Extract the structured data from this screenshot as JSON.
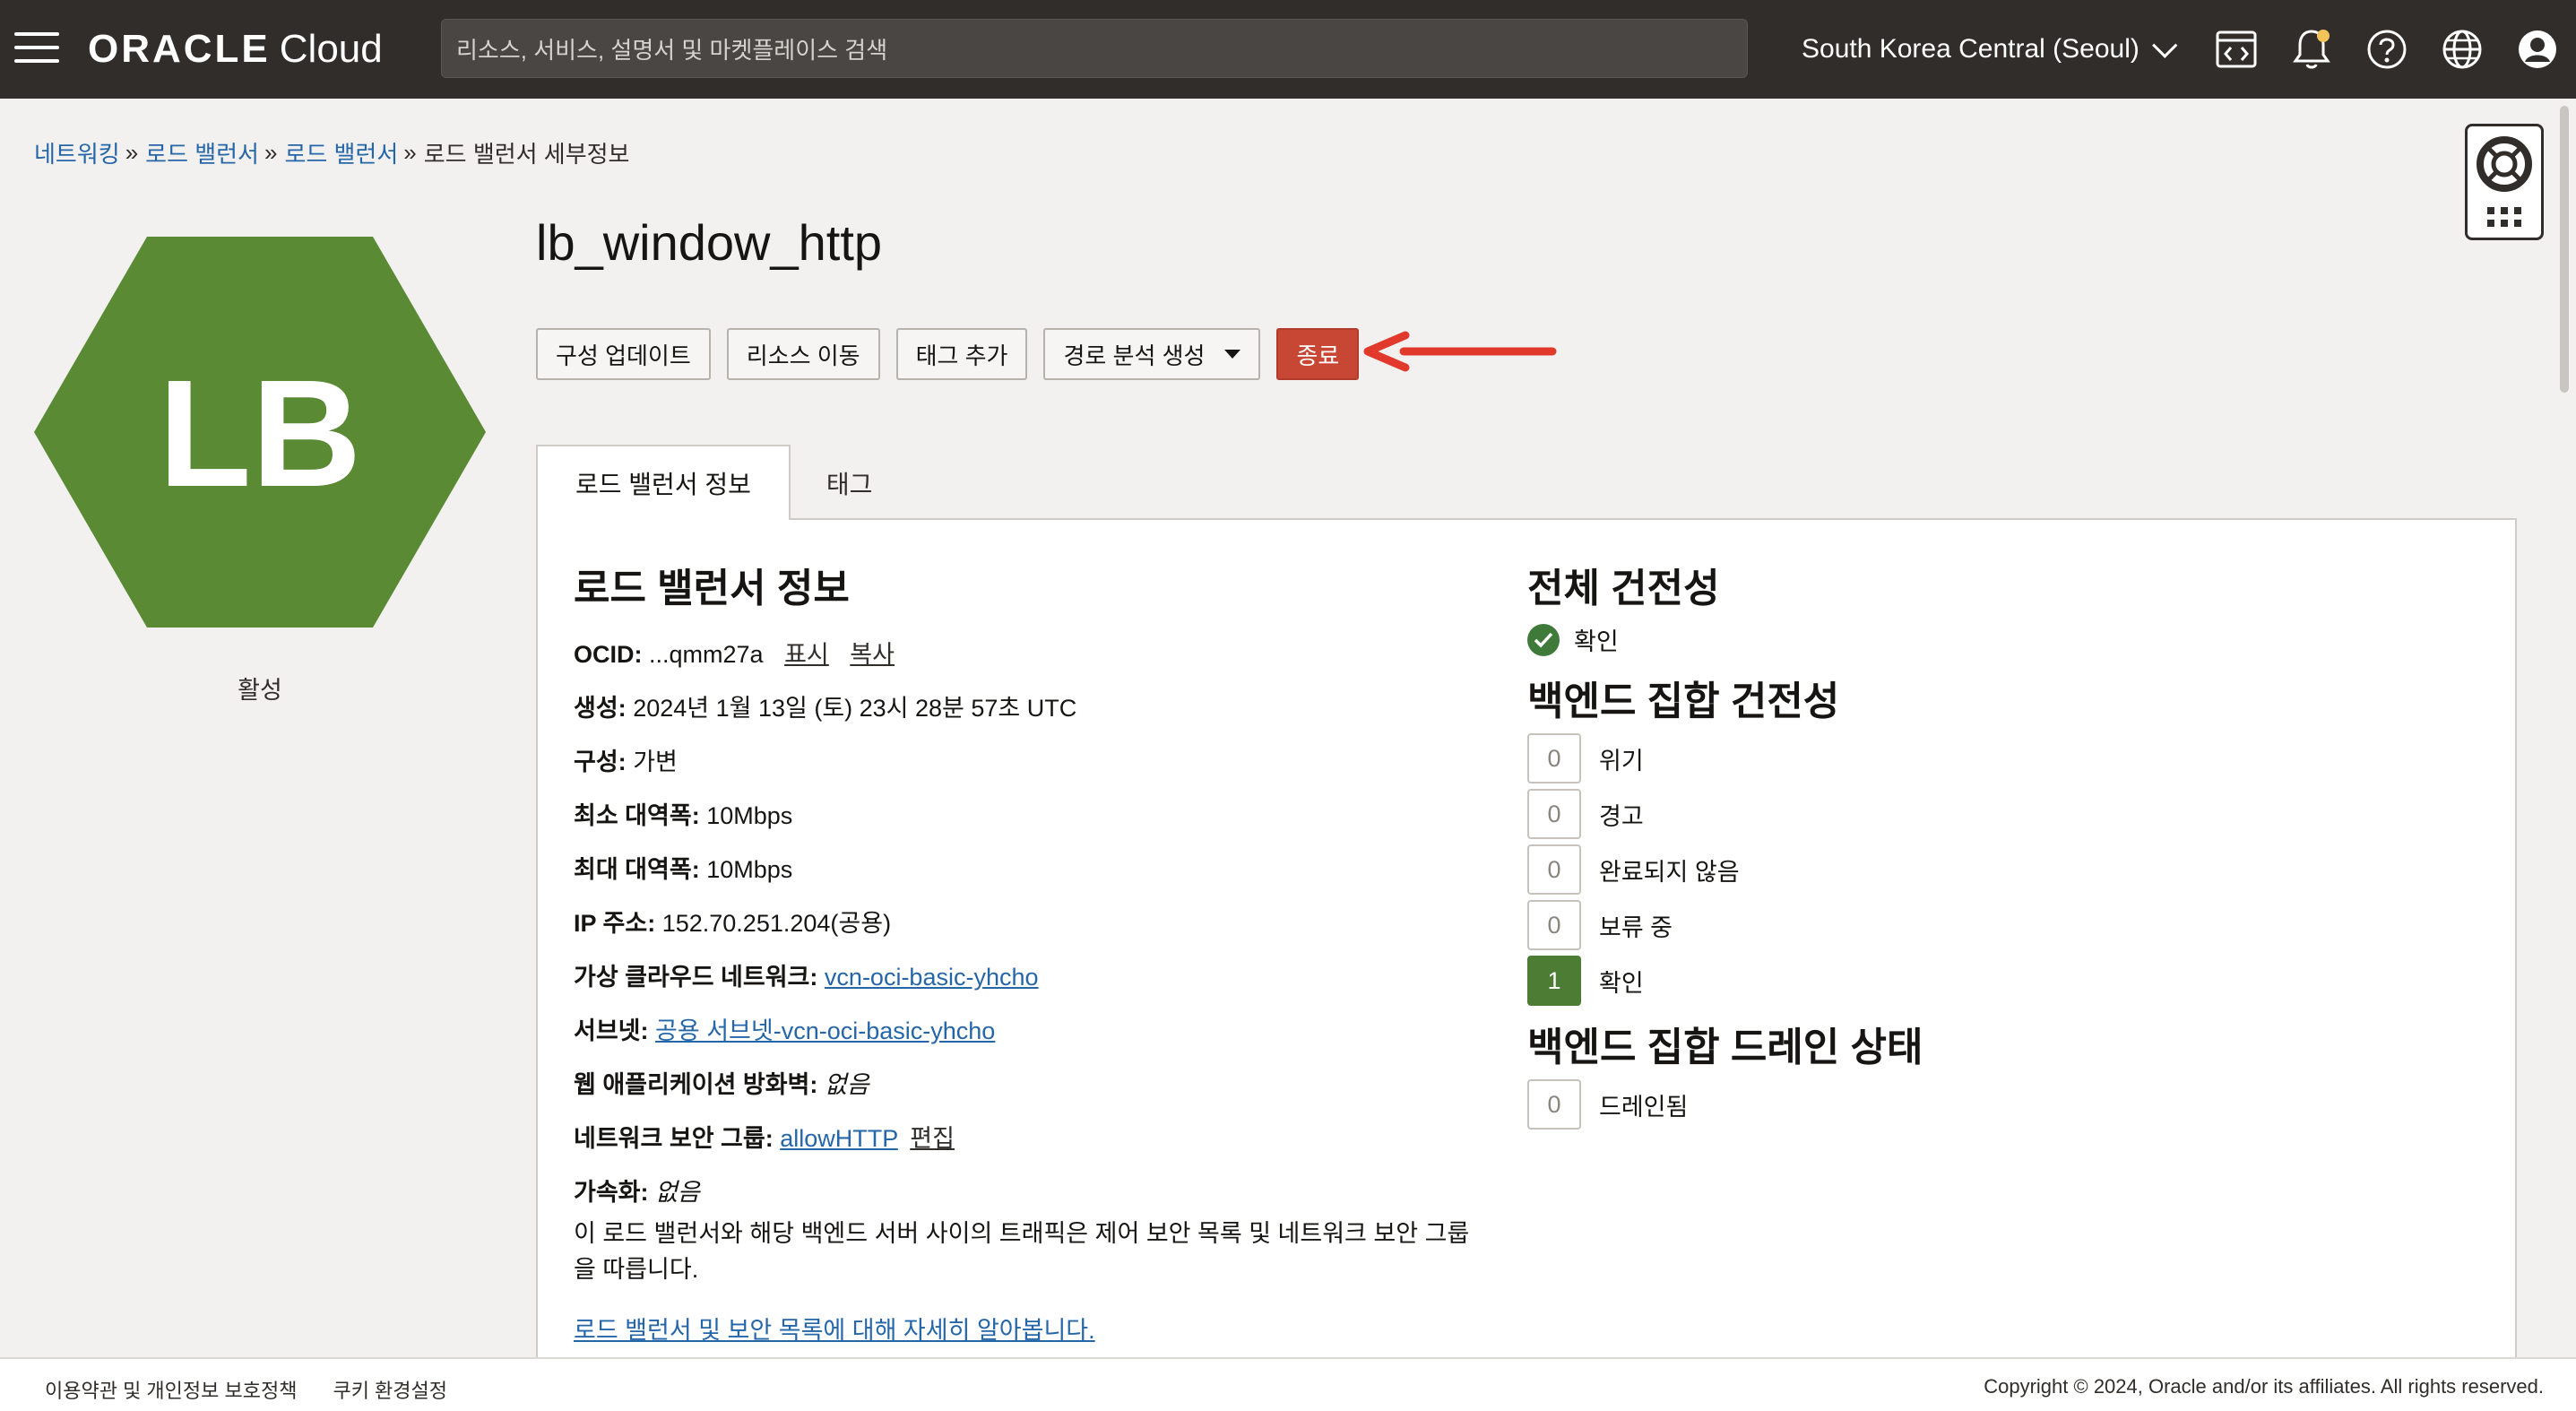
{
  "header": {
    "logo_oracle": "ORACLE",
    "logo_cloud": "Cloud",
    "search_placeholder": "리소스, 서비스, 설명서 및 마켓플레이스 검색",
    "region": "South Korea Central (Seoul)"
  },
  "breadcrumb": {
    "items": [
      "네트워킹",
      "로드 밸런서",
      "로드 밸런서"
    ],
    "current": "로드 밸런서 세부정보"
  },
  "badge": {
    "initials": "LB",
    "status": "활성",
    "color": "#5a8a34"
  },
  "title": "lb_window_http",
  "actions": {
    "update_config": "구성 업데이트",
    "move_resource": "리소스 이동",
    "add_tag": "태그 추가",
    "path_analysis": "경로 분석 생성",
    "terminate": "종료"
  },
  "tabs": {
    "info": "로드 밸런서 정보",
    "tags": "태그"
  },
  "info": {
    "heading": "로드 밸런서 정보",
    "ocid_label": "OCID:",
    "ocid_value": "...qmm27a",
    "ocid_show": "표시",
    "ocid_copy": "복사",
    "created_label": "생성:",
    "created_value": "2024년 1월 13일 (토) 23시 28분 57초 UTC",
    "shape_label": "구성:",
    "shape_value": "가변",
    "min_bw_label": "최소 대역폭:",
    "min_bw_value": "10Mbps",
    "max_bw_label": "최대 대역폭:",
    "max_bw_value": "10Mbps",
    "ip_label": "IP 주소:",
    "ip_value": "152.70.251.204(공용)",
    "vcn_label": "가상 클라우드 네트워크:",
    "vcn_value": "vcn-oci-basic-yhcho",
    "subnet_label": "서브넷:",
    "subnet_value": "공용 서브넷-vcn-oci-basic-yhcho",
    "waf_label": "웹 애플리케이션 방화벽:",
    "waf_value": "없음",
    "nsg_label": "네트워크 보안 그룹:",
    "nsg_value": "allowHTTP",
    "nsg_edit": "편집",
    "accel_label": "가속화:",
    "accel_value": "없음",
    "note": "이 로드 밸런서와 해당 백엔드 서버 사이의 트래픽은 제어 보안 목록 및 네트워크 보안 그룹을 따릅니다.",
    "learn_more": "로드 밸런서 및 보안 목록에 대해 자세히 알아봅니다."
  },
  "health": {
    "overall_heading": "전체 건전성",
    "overall_status": "확인",
    "backend_heading": "백엔드 집합 건전성",
    "backend_counts": [
      {
        "count": "0",
        "label": "위기"
      },
      {
        "count": "0",
        "label": "경고"
      },
      {
        "count": "0",
        "label": "완료되지 않음"
      },
      {
        "count": "0",
        "label": "보류 중"
      },
      {
        "count": "1",
        "label": "확인"
      }
    ],
    "drain_heading": "백엔드 집합 드레인 상태",
    "drain_count": "0",
    "drain_label": "드레인됨"
  },
  "footer": {
    "terms": "이용약관 및 개인정보 보호정책",
    "cookies": "쿠키 환경설정",
    "copyright": "Copyright © 2024, Oracle and/or its affiliates. All rights reserved."
  }
}
